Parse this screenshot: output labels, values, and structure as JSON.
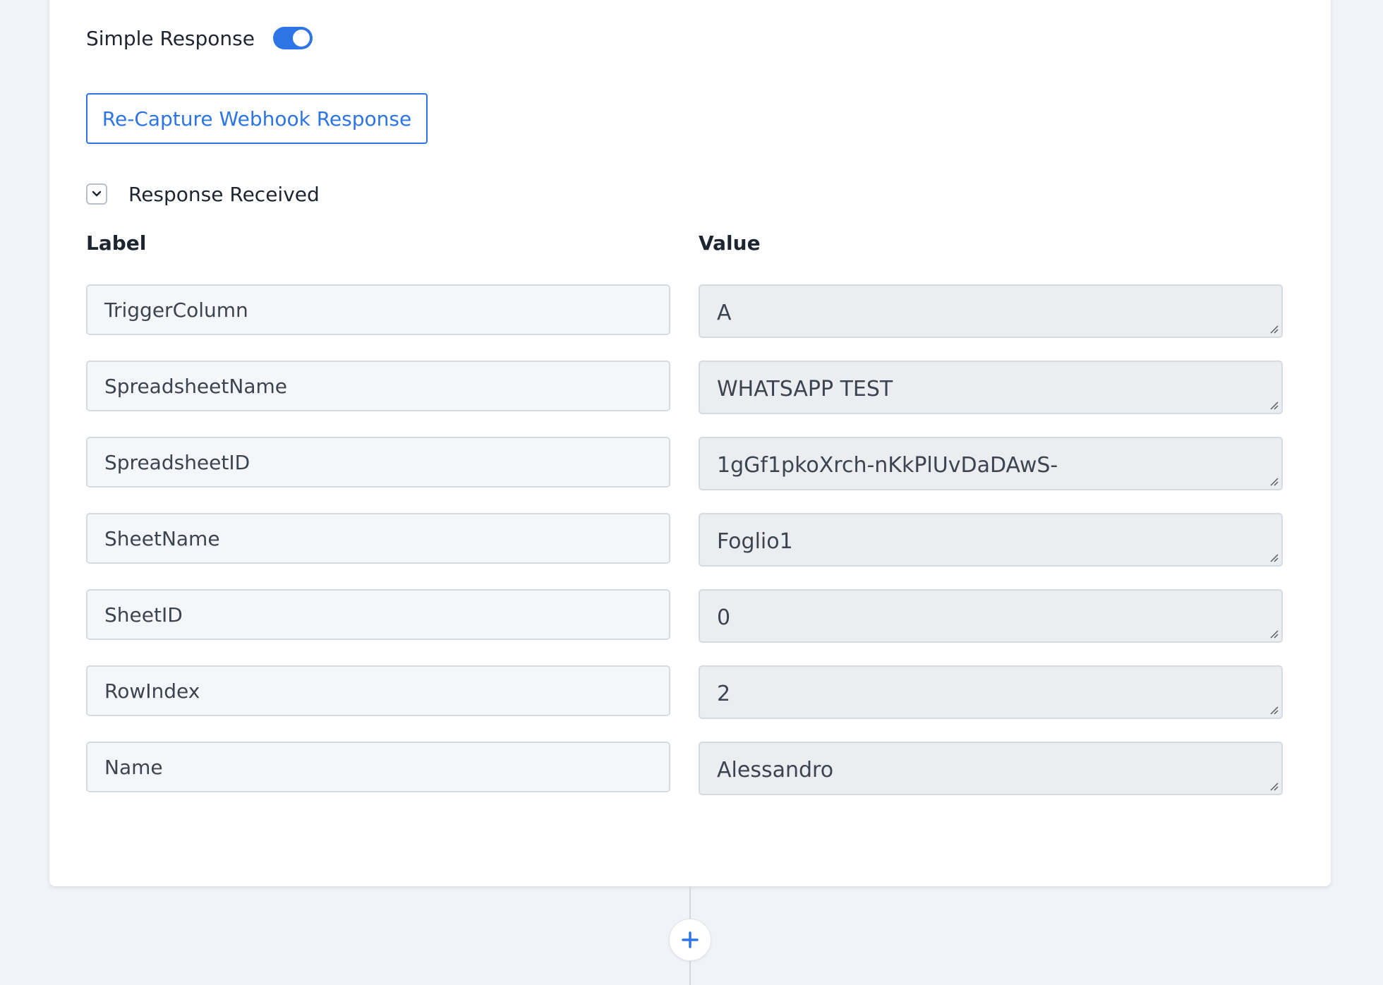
{
  "settings": {
    "simple_response_label": "Simple Response",
    "simple_response_enabled": true,
    "recapture_label": "Re-Capture Webhook Response"
  },
  "response": {
    "section_title": "Response Received",
    "label_header": "Label",
    "value_header": "Value",
    "rows": [
      {
        "label": "TriggerColumn",
        "value": "A"
      },
      {
        "label": "SpreadsheetName",
        "value": "WHATSAPP TEST"
      },
      {
        "label": "SpreadsheetID",
        "value": "1gGf1pkoXrch-nKkPlUvDaDAwS-"
      },
      {
        "label": "SheetName",
        "value": "Foglio1"
      },
      {
        "label": "SheetID",
        "value": "0"
      },
      {
        "label": "RowIndex",
        "value": "2"
      },
      {
        "label": "Name",
        "value": "Alessandro"
      }
    ]
  },
  "icons": {
    "collapse": "chevron-down-icon",
    "add": "plus-icon",
    "resize": "resize-grip-icon"
  },
  "colors": {
    "accent": "#2d74e6"
  }
}
